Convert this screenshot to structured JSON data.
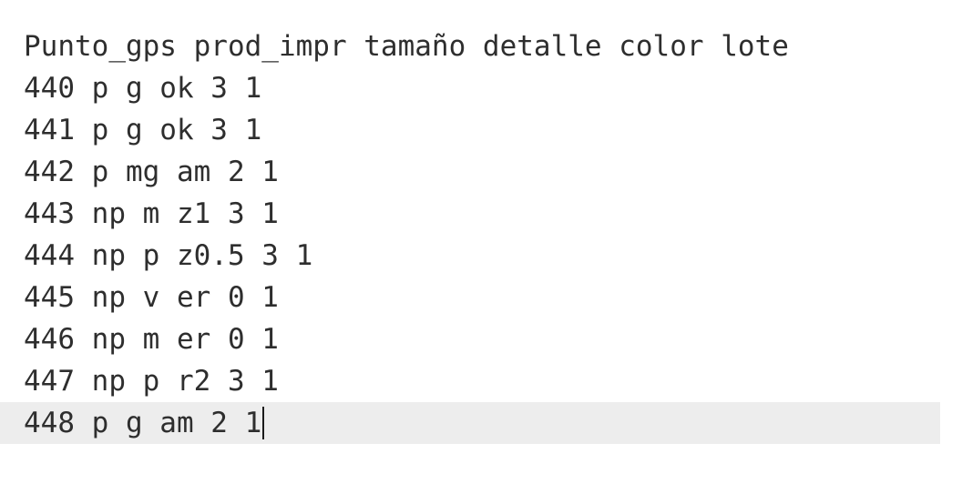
{
  "editor": {
    "lines": [
      "Punto_gps prod_impr tamaño detalle color lote",
      "440 p g ok 3 1",
      "441 p g ok 3 1",
      "442 p mg am 2 1",
      "443 np m z1 3 1",
      "444 np p z0.5 3 1",
      "445 np v er 0 1",
      "446 np m er 0 1",
      "447 np p r2 3 1",
      "448 p g am 2 1"
    ],
    "current_line_color": "#ededed",
    "text_color": "#2e2e2e"
  }
}
